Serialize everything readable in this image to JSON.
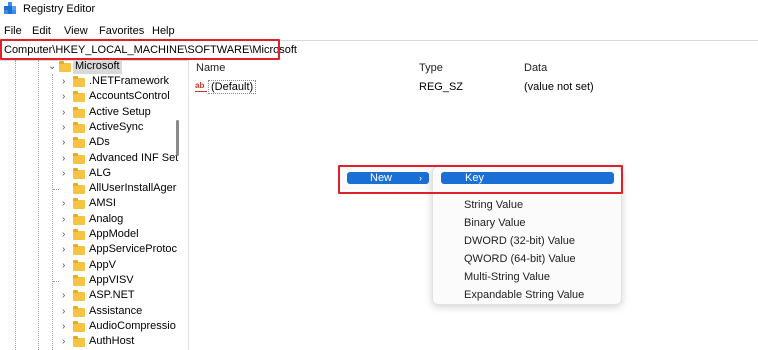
{
  "window": {
    "title": "Registry Editor"
  },
  "menubar": {
    "items": [
      "File",
      "Edit",
      "View",
      "Favorites",
      "Help"
    ]
  },
  "address": {
    "path": "Computer\\HKEY_LOCAL_MACHINE\\SOFTWARE\\Microsoft"
  },
  "tree": {
    "selected": "Microsoft",
    "items": [
      ".NETFramework",
      "AccountsControl",
      "Active Setup",
      "ActiveSync",
      "ADs",
      "Advanced INF Set",
      "ALG",
      "AllUserInstallAger",
      "AMSI",
      "Analog",
      "AppModel",
      "AppServiceProtoc",
      "AppV",
      "AppVISV",
      "ASP.NET",
      "Assistance",
      "AudioCompressio",
      "AuthHost"
    ]
  },
  "values_pane": {
    "columns": {
      "name": "Name",
      "type": "Type",
      "data": "Data"
    },
    "rows": [
      {
        "icon": "ab",
        "name": "(Default)",
        "type": "REG_SZ",
        "data": "(value not set)"
      }
    ]
  },
  "context_menu": {
    "new_label": "New",
    "submenu": {
      "key_label": "Key",
      "items": [
        "String Value",
        "Binary Value",
        "DWORD (32-bit) Value",
        "QWORD (64-bit) Value",
        "Multi-String Value",
        "Expandable String Value"
      ]
    }
  },
  "colors": {
    "highlight": "#e0212a",
    "menu_selected": "#1a6fd6",
    "folder": "#f6c343"
  }
}
